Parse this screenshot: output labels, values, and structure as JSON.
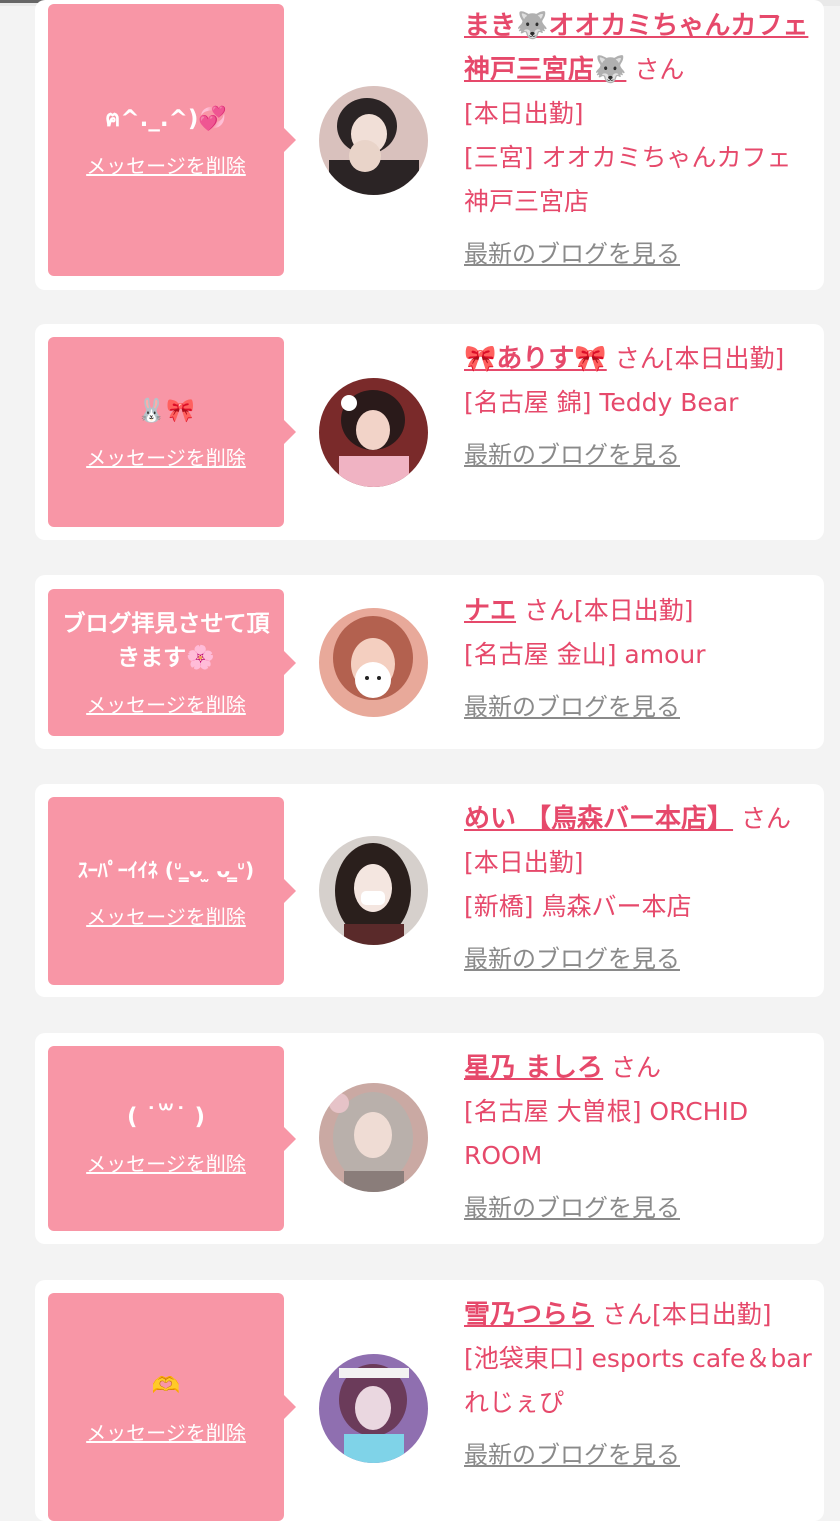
{
  "cards": [
    {
      "message": "ฅ^._.^)💞",
      "delete_label": "メッセージを削除",
      "name": "まき🐺オオカミちゃんカフェ神戸三宮店🐺",
      "suffix": "さん",
      "status": "[本日出勤]",
      "location": "[三宮] オオカミちゃんカフェ神戸三宮店",
      "blog_link": "最新のブログを見る",
      "avatar_colors": [
        "#d9c1bd",
        "#2b2425",
        "#e9d4c9"
      ]
    },
    {
      "message": "🐰🎀",
      "delete_label": "メッセージを削除",
      "name": "🎀ありす🎀",
      "suffix": "さん",
      "status": "[本日出勤]",
      "location": "[名古屋 錦] Teddy Bear",
      "blog_link": "最新のブログを見る",
      "avatar_colors": [
        "#7a2a2a",
        "#2a1a1a",
        "#f2d3c8"
      ]
    },
    {
      "message": "ブログ拝見させて頂きます🌸",
      "delete_label": "メッセージを削除",
      "name": "ナエ",
      "suffix": "さん",
      "status": "[本日出勤]",
      "location": "[名古屋 金山] amour",
      "blog_link": "最新のブログを見る",
      "avatar_colors": [
        "#e8a99a",
        "#b3614f",
        "#ffffff"
      ]
    },
    {
      "message": "ｽｰﾊﾟｰｲｲﾈ (ᐡ ̳ᴗ ̫ ᴗ ̳ᐡ)",
      "delete_label": "メッセージを削除",
      "name": "めい 【鳥森バー本店】",
      "suffix": "さん",
      "status": "[本日出勤]",
      "location": "[新橋] 鳥森バー本店",
      "blog_link": "最新のブログを見る",
      "avatar_colors": [
        "#d6d0cc",
        "#2a1f1c",
        "#f4e6e0"
      ]
    },
    {
      "message": "( ˙꒳​˙ )",
      "delete_label": "メッセージを削除",
      "name": "星乃 ましろ",
      "suffix": "さん",
      "status": "",
      "location": "[名古屋 大曽根] ORCHID ROOM",
      "blog_link": "最新のブログを見る",
      "avatar_colors": [
        "#caa9a3",
        "#8a7d7a",
        "#efdcd4"
      ]
    },
    {
      "message": "🫶",
      "delete_label": "メッセージを削除",
      "name": "雪乃つらら",
      "suffix": "さん",
      "status": "[本日出勤]",
      "location": "[池袋東口] esports cafe＆bar れじぇぴ",
      "blog_link": "最新のブログを見る",
      "avatar_colors": [
        "#8f6fb0",
        "#6b3b5a",
        "#ead7e0"
      ]
    }
  ]
}
